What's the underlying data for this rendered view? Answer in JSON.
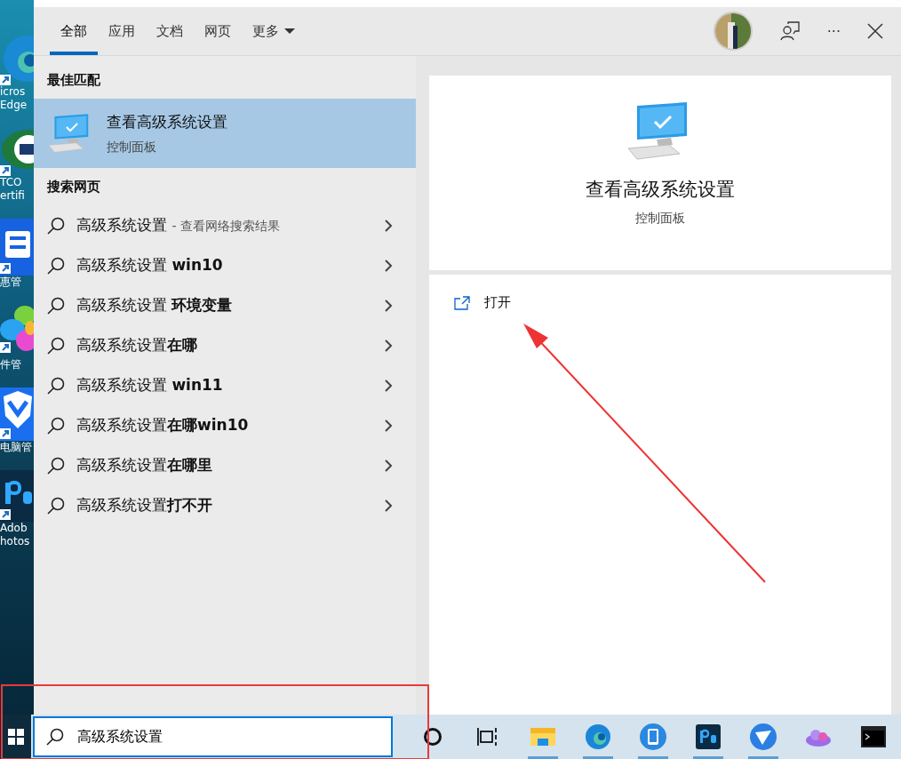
{
  "desktop_icons": [
    {
      "kind": "edge",
      "lines": [
        "icros",
        "Edge"
      ]
    },
    {
      "kind": "tco",
      "lines": [
        "TCO",
        "ertifi"
      ]
    },
    {
      "kind": "hui",
      "lines": [
        "惠管"
      ]
    },
    {
      "kind": "petals",
      "lines": [
        "件管"
      ]
    },
    {
      "kind": "shield",
      "lines": [
        "电脑管"
      ]
    },
    {
      "kind": "ps",
      "lines": [
        "Adob",
        "hotos"
      ]
    }
  ],
  "tabs": [
    {
      "label": "全部",
      "selected": true
    },
    {
      "label": "应用",
      "selected": false
    },
    {
      "label": "文档",
      "selected": false
    },
    {
      "label": "网页",
      "selected": false
    },
    {
      "label": "更多",
      "selected": false,
      "dropdown": true
    }
  ],
  "header_actions": [
    {
      "kind": "avatar"
    },
    {
      "kind": "feedback"
    },
    {
      "kind": "more",
      "label": "···"
    },
    {
      "kind": "close"
    }
  ],
  "best_match": {
    "heading": "最佳匹配",
    "title": "查看高级系统设置",
    "subtitle": "控制面板",
    "selected": true
  },
  "web_search": {
    "heading": "搜索网页",
    "items": [
      {
        "text": "高级系统设置",
        "hint": "- 查看网络搜索结果"
      },
      {
        "text": "高级系统设置 **win10**"
      },
      {
        "text": "高级系统设置 **环境变量**"
      },
      {
        "text": "高级系统设置**在哪**"
      },
      {
        "text": "高级系统设置 **win11**"
      },
      {
        "text": "高级系统设置**在哪win10**"
      },
      {
        "text": "高级系统设置**在哪里**"
      },
      {
        "text": "高级系统设置**打不开**"
      }
    ]
  },
  "preview": {
    "title": "查看高级系统设置",
    "subtitle": "控制面板",
    "actions": [
      {
        "label": "打开"
      }
    ]
  },
  "taskbar": {
    "search_value": "高级系统设置",
    "apps": [
      {
        "kind": "cortana"
      },
      {
        "kind": "taskview"
      },
      {
        "kind": "folder",
        "active": true
      },
      {
        "kind": "edge",
        "active": true
      },
      {
        "kind": "phone",
        "active": true
      },
      {
        "kind": "ps",
        "active": true
      },
      {
        "kind": "bird",
        "active": true
      },
      {
        "kind": "cloud",
        "active": false
      },
      {
        "kind": "terminal",
        "active": false
      }
    ]
  }
}
